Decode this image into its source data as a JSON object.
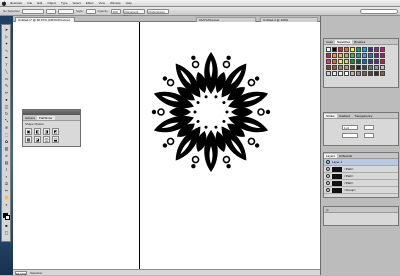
{
  "menubar": {
    "items": [
      "Illustrator",
      "File",
      "Edit",
      "Object",
      "Type",
      "Select",
      "Effect",
      "View",
      "Window",
      "Help"
    ],
    "clock": ""
  },
  "appbar": {
    "label": "No Selection",
    "style_label": "Style:",
    "opacity_label": "Opacity:",
    "opacity_value": "100",
    "doc_setup": "Document Setup",
    "preferences": "Preferences"
  },
  "document": {
    "tabs": [
      "Untitled-1* @ 66.67% (CMYK/Preview)",
      "CMYK/Preview",
      "Untitled-3 @ 100%"
    ],
    "zoom": "66.67%",
    "status": "Selection"
  },
  "float_panel": {
    "tabs": [
      "Actions",
      "Pathfinder"
    ],
    "title": "Shape Modes:",
    "buttons": [
      "▣",
      "◧",
      "◨",
      "◩"
    ]
  },
  "right_dock": {
    "swatches_tabs": [
      "Color",
      "Swatches",
      "Brushes"
    ],
    "stroke_tabs": [
      "Stroke",
      "Gradient",
      "Transparency"
    ],
    "stroke_weight": "1 pt",
    "layers_tabs": [
      "Layers",
      "Artboards"
    ],
    "layers": [
      "Layer 1",
      "<Path>",
      "<Path>",
      "<Path>",
      "<Group>"
    ],
    "swatch_colors": [
      "#ffffff",
      "#000000",
      "#ed1c24",
      "#f26522",
      "#fff200",
      "#00a651",
      "#00aeef",
      "#2e3192",
      "#92278f",
      "#ec008c",
      "#c1272d",
      "#f7941d",
      "#fbb040",
      "#8dc63f",
      "#39b54a",
      "#00a99d",
      "#27aae1",
      "#1c75bc",
      "#662d91",
      "#9e1f63",
      "#ee2a7b",
      "#f15a29",
      "#f9ed32",
      "#d7df23",
      "#009444",
      "#006838",
      "#0072bc",
      "#21409a",
      "#5b2a86",
      "#be1e2d",
      "#754c24",
      "#8b5e3c",
      "#a97c50",
      "#c49a6c",
      "#603913",
      "#231f20",
      "#414042",
      "#6d6e71",
      "#939598",
      "#bcbec0",
      "#d1d3d4",
      "#e6e7e8",
      "#f1f2f2",
      "#ffffff",
      "#c7b299",
      "#998675",
      "#736357",
      "#534741",
      "#362f2d",
      "#8c6239"
    ]
  }
}
